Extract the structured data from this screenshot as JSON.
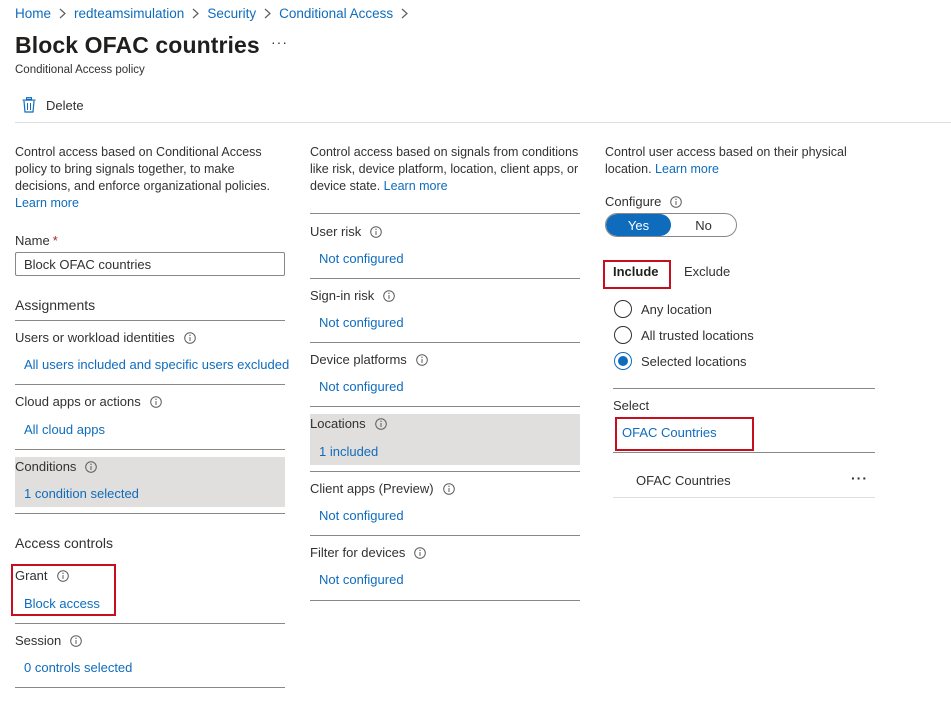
{
  "breadcrumb": [
    "Home",
    "redteamsimulation",
    "Security",
    "Conditional Access"
  ],
  "page": {
    "title": "Block OFAC countries",
    "subtitle": "Conditional Access policy",
    "more": "···"
  },
  "toolbar": {
    "delete_label": "Delete"
  },
  "col1": {
    "intro": "Control access based on Conditional Access policy to bring signals together, to make decisions, and enforce organizational policies.",
    "learn_more": "Learn more",
    "name_label": "Name",
    "name_required": "*",
    "name_value": "Block OFAC countries",
    "assignments": "Assignments",
    "users_label": "Users or workload identities",
    "users_value": "All users included and specific users excluded",
    "cloud_label": "Cloud apps or actions",
    "cloud_value": "All cloud apps",
    "conditions_label": "Conditions",
    "conditions_value": "1 condition selected",
    "access_controls": "Access controls",
    "grant_label": "Grant",
    "grant_value": "Block access",
    "session_label": "Session",
    "session_value": "0 controls selected"
  },
  "col2": {
    "intro": "Control access based on signals from conditions like risk, device platform, location, client apps, or device state.",
    "learn_more": "Learn more",
    "user_risk_label": "User risk",
    "user_risk_value": "Not configured",
    "signin_risk_label": "Sign-in risk",
    "signin_risk_value": "Not configured",
    "device_platforms_label": "Device platforms",
    "device_platforms_value": "Not configured",
    "locations_label": "Locations",
    "locations_value": "1 included",
    "client_apps_label": "Client apps (Preview)",
    "client_apps_value": "Not configured",
    "filter_devices_label": "Filter for devices",
    "filter_devices_value": "Not configured"
  },
  "col3": {
    "intro": "Control user access based on their physical location.",
    "learn_more": "Learn more",
    "configure_label": "Configure",
    "toggle_yes": "Yes",
    "toggle_no": "No",
    "toggle_selected": "Yes",
    "tab_include": "Include",
    "tab_exclude": "Exclude",
    "radio_any": "Any location",
    "radio_trusted": "All trusted locations",
    "radio_selected": "Selected locations",
    "radio_checked": "Selected locations",
    "select_label": "Select",
    "select_value": "OFAC Countries",
    "selected_item": "OFAC Countries",
    "item_more": "···"
  },
  "colors": {
    "link": "#0f6cbd",
    "highlight_border": "#c50f1f",
    "shaded_row": "#e1dfdd"
  },
  "icons": {
    "delete": "trash-icon",
    "info": "info-icon",
    "breadcrumb_sep": "chevron-right-icon"
  }
}
